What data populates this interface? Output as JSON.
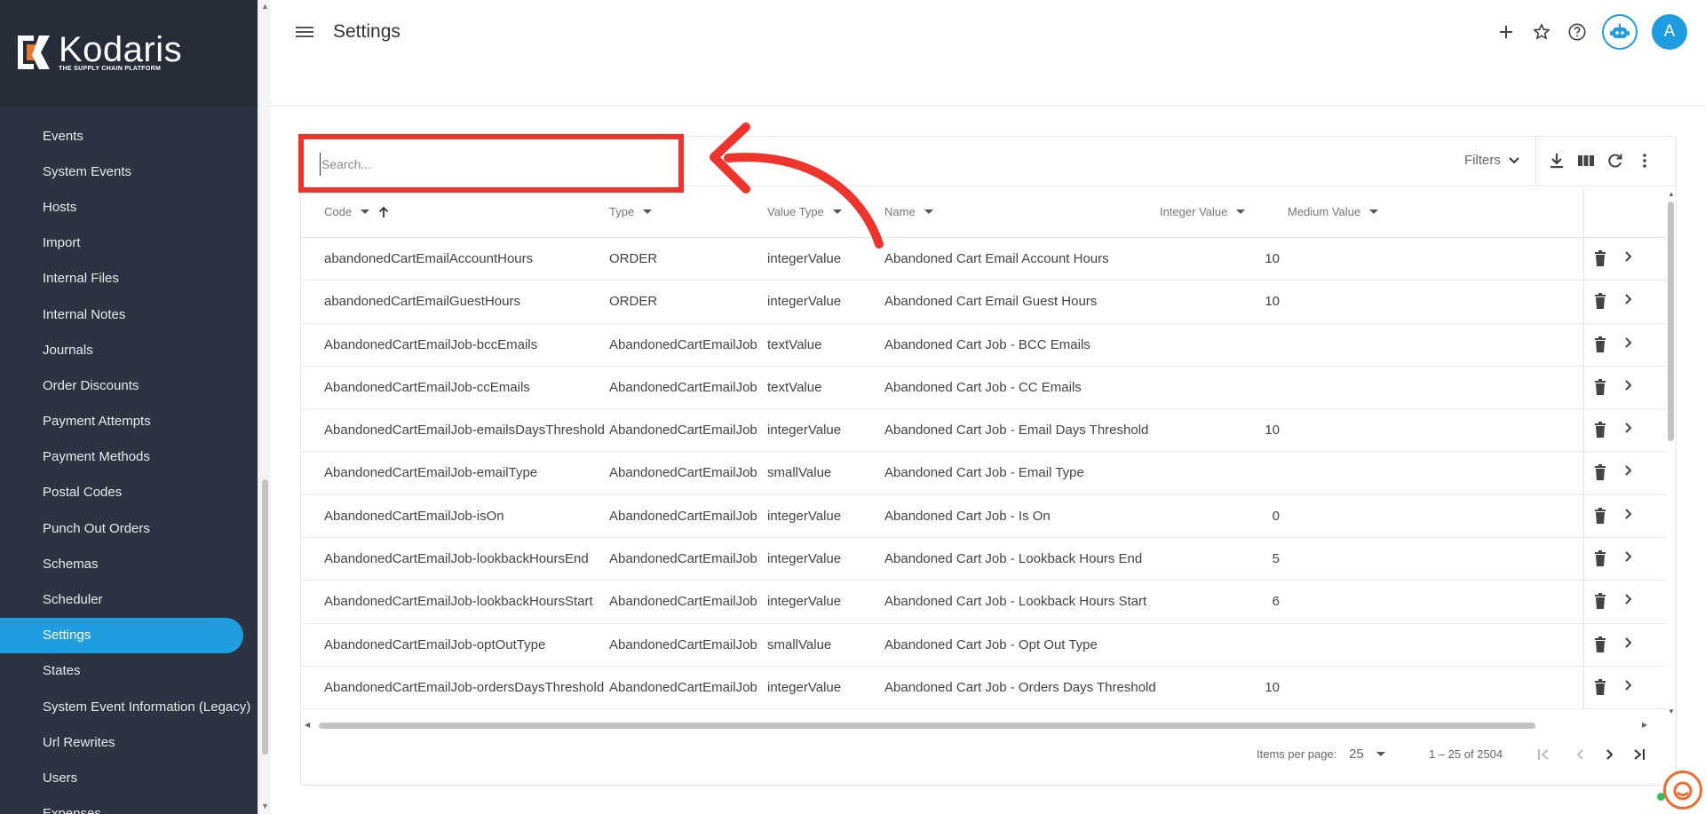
{
  "sidebar": {
    "logo_title": "Kodaris",
    "logo_subtitle": "THE SUPPLY CHAIN PLATFORM",
    "items": [
      {
        "label": "Events"
      },
      {
        "label": "System Events"
      },
      {
        "label": "Hosts"
      },
      {
        "label": "Import"
      },
      {
        "label": "Internal Files"
      },
      {
        "label": "Internal Notes"
      },
      {
        "label": "Journals"
      },
      {
        "label": "Order Discounts"
      },
      {
        "label": "Payment Attempts"
      },
      {
        "label": "Payment Methods"
      },
      {
        "label": "Postal Codes"
      },
      {
        "label": "Punch Out Orders"
      },
      {
        "label": "Schemas"
      },
      {
        "label": "Scheduler"
      },
      {
        "label": "Settings",
        "active": true
      },
      {
        "label": "States"
      },
      {
        "label": "System Event Information (Legacy)"
      },
      {
        "label": "Url Rewrites"
      },
      {
        "label": "Users"
      },
      {
        "label": "Expenses"
      }
    ]
  },
  "header": {
    "title": "Settings",
    "avatar_initial": "A",
    "icons": [
      "add-icon",
      "star-icon",
      "help-icon",
      "robot-icon"
    ]
  },
  "search": {
    "placeholder": "Search..."
  },
  "toolbar": {
    "filters_label": "Filters"
  },
  "table": {
    "columns": [
      "Code",
      "Type",
      "Value Type",
      "Name",
      "Integer Value",
      "Medium Value"
    ],
    "rows": [
      {
        "code": "abandonedCartEmailAccountHours",
        "type": "ORDER",
        "value_type": "integerValue",
        "name": "Abandoned Cart Email Account Hours",
        "integer_value": "10"
      },
      {
        "code": "abandonedCartEmailGuestHours",
        "type": "ORDER",
        "value_type": "integerValue",
        "name": "Abandoned Cart Email Guest Hours",
        "integer_value": "10"
      },
      {
        "code": "AbandonedCartEmailJob-bccEmails",
        "type": "AbandonedCartEmailJob",
        "value_type": "textValue",
        "name": "Abandoned Cart Job - BCC Emails",
        "integer_value": ""
      },
      {
        "code": "AbandonedCartEmailJob-ccEmails",
        "type": "AbandonedCartEmailJob",
        "value_type": "textValue",
        "name": "Abandoned Cart Job - CC Emails",
        "integer_value": ""
      },
      {
        "code": "AbandonedCartEmailJob-emailsDaysThreshold",
        "type": "AbandonedCartEmailJob",
        "value_type": "integerValue",
        "name": "Abandoned Cart Job - Email Days Threshold",
        "integer_value": "10"
      },
      {
        "code": "AbandonedCartEmailJob-emailType",
        "type": "AbandonedCartEmailJob",
        "value_type": "smallValue",
        "name": "Abandoned Cart Job - Email Type",
        "integer_value": ""
      },
      {
        "code": "AbandonedCartEmailJob-isOn",
        "type": "AbandonedCartEmailJob",
        "value_type": "integerValue",
        "name": "Abandoned Cart Job - Is On",
        "integer_value": "0"
      },
      {
        "code": "AbandonedCartEmailJob-lookbackHoursEnd",
        "type": "AbandonedCartEmailJob",
        "value_type": "integerValue",
        "name": "Abandoned Cart Job - Lookback Hours End",
        "integer_value": "5"
      },
      {
        "code": "AbandonedCartEmailJob-lookbackHoursStart",
        "type": "AbandonedCartEmailJob",
        "value_type": "integerValue",
        "name": "Abandoned Cart Job - Lookback Hours Start",
        "integer_value": "6"
      },
      {
        "code": "AbandonedCartEmailJob-optOutType",
        "type": "AbandonedCartEmailJob",
        "value_type": "smallValue",
        "name": "Abandoned Cart Job - Opt Out Type",
        "integer_value": ""
      },
      {
        "code": "AbandonedCartEmailJob-ordersDaysThreshold",
        "type": "AbandonedCartEmailJob",
        "value_type": "integerValue",
        "name": "Abandoned Cart Job - Orders Days Threshold",
        "integer_value": "10"
      }
    ]
  },
  "pagination": {
    "items_per_page_label": "Items per page:",
    "page_size": "25",
    "range": "1 – 25 of 2504"
  },
  "colors": {
    "accent": "#1e9de0",
    "sidebar": "#2b3440",
    "annotation": "#f0332b"
  }
}
